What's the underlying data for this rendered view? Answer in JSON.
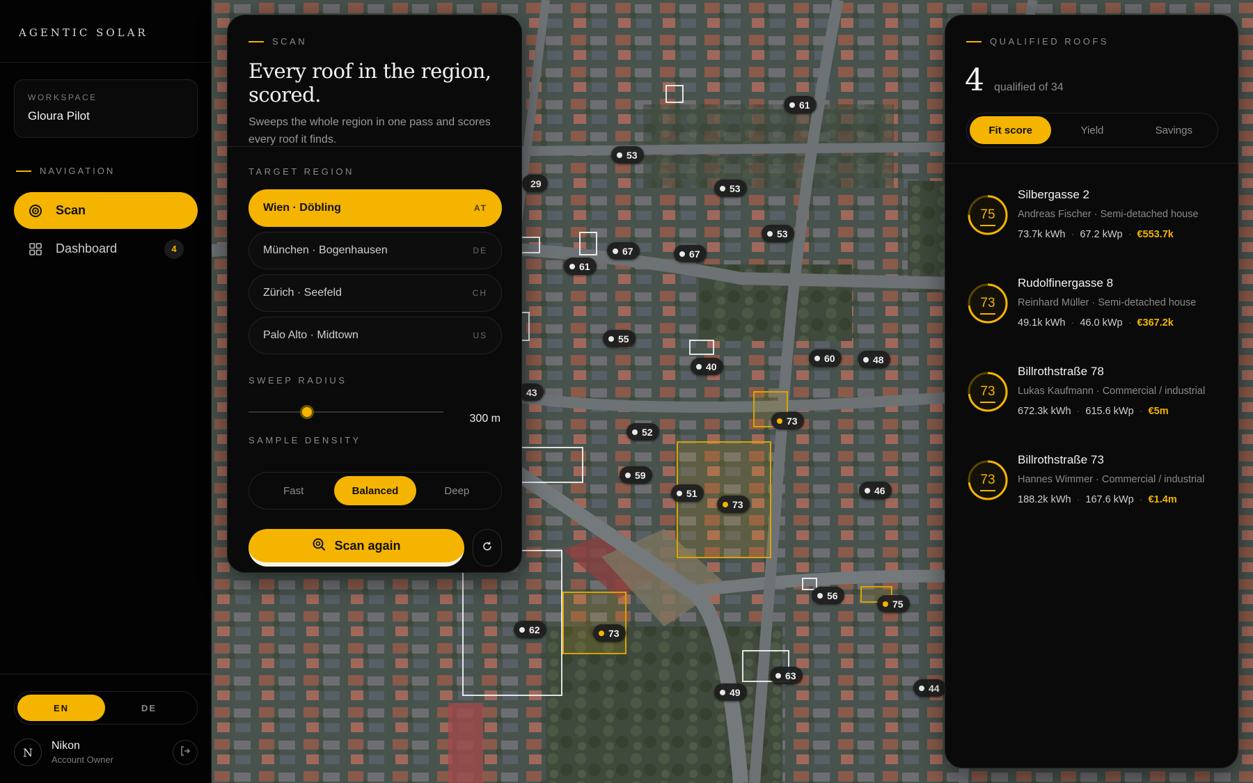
{
  "app": {
    "brand": "AGENTIC SOLAR"
  },
  "workspace": {
    "label": "WORKSPACE",
    "name": "Gloura Pilot"
  },
  "navigation": {
    "title": "NAVIGATION",
    "items": [
      {
        "label": "Scan",
        "icon": "scan-target-icon",
        "active": true
      },
      {
        "label": "Dashboard",
        "icon": "grid-icon",
        "badge": "4"
      }
    ]
  },
  "language": {
    "options": [
      "EN",
      "DE"
    ],
    "selected": "EN"
  },
  "user": {
    "initial": "N",
    "name": "Nikon",
    "role": "Account Owner"
  },
  "scan_panel": {
    "eyebrow": "SCAN",
    "title": "Every roof in the region, scored.",
    "description": "Sweeps the whole region in one pass and scores every roof it finds.",
    "target_region_label": "TARGET REGION",
    "regions": [
      {
        "name": "Wien · Döbling",
        "code": "AT",
        "active": true
      },
      {
        "name": "München · Bogenhausen",
        "code": "DE"
      },
      {
        "name": "Zürich · Seefeld",
        "code": "CH"
      },
      {
        "name": "Palo Alto · Midtown",
        "code": "US"
      }
    ],
    "sweep_radius_label": "SWEEP RADIUS",
    "sweep_radius_value": "300 m",
    "sweep_radius_fraction": 0.3,
    "sample_density_label": "SAMPLE DENSITY",
    "density_options": [
      "Fast",
      "Balanced",
      "Deep"
    ],
    "density_selected": "Balanced",
    "scan_button": "Scan again"
  },
  "map": {
    "pins": [
      {
        "score": "61"
      },
      {
        "score": "53"
      },
      {
        "score": "29"
      },
      {
        "score": "53"
      },
      {
        "score": "53"
      },
      {
        "score": "67"
      },
      {
        "score": "67"
      },
      {
        "score": "61"
      },
      {
        "score": "55"
      },
      {
        "score": "60"
      },
      {
        "score": "48"
      },
      {
        "score": "40"
      },
      {
        "score": "43"
      },
      {
        "score": "73",
        "qualified": true
      },
      {
        "score": "52"
      },
      {
        "score": "59"
      },
      {
        "score": "51"
      },
      {
        "score": "73",
        "qualified": true
      },
      {
        "score": "46"
      },
      {
        "score": "62"
      },
      {
        "score": "73",
        "qualified": true
      },
      {
        "score": "56"
      },
      {
        "score": "75",
        "qualified": true
      },
      {
        "score": "63"
      },
      {
        "score": "49"
      },
      {
        "score": "44"
      }
    ]
  },
  "qualified_panel": {
    "eyebrow": "QUALIFIED ROOFS",
    "count": "4",
    "of_text": "qualified of 34",
    "sort_tabs": [
      "Fit score",
      "Yield",
      "Savings"
    ],
    "sort_selected": "Fit score",
    "roofs": [
      {
        "score": "75",
        "score_value": 75,
        "address": "Silbergasse 2",
        "owner": "Andreas Fischer · Semi-detached house",
        "energy": "73.7k kWh",
        "power": "67.2 kWp",
        "savings": "€553.7k"
      },
      {
        "score": "73",
        "score_value": 73,
        "address": "Rudolfinergasse 8",
        "owner": "Reinhard Müller · Semi-detached house",
        "energy": "49.1k kWh",
        "power": "46.0 kWp",
        "savings": "€367.2k"
      },
      {
        "score": "73",
        "score_value": 73,
        "address": "Billrothstraße 78",
        "owner": "Lukas Kaufmann · Commercial / industrial",
        "energy": "672.3k kWh",
        "power": "615.6 kWp",
        "savings": "€5m"
      },
      {
        "score": "73",
        "score_value": 73,
        "address": "Billrothstraße 73",
        "owner": "Hannes Wimmer · Commercial / industrial",
        "energy": "188.2k kWh",
        "power": "167.6 kWp",
        "savings": "€1.4m"
      }
    ]
  },
  "colors": {
    "accent": "#f4b400",
    "background": "#050505",
    "panel": "#0a0a0a"
  }
}
